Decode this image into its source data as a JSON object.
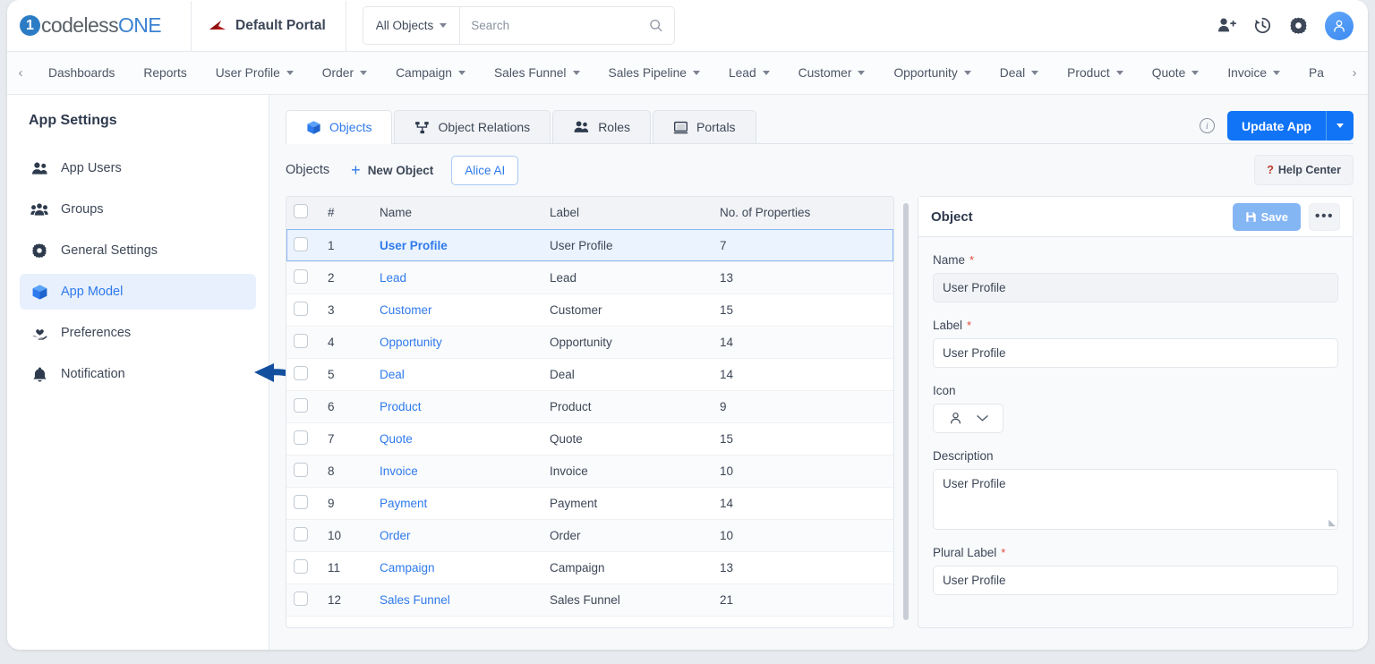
{
  "brand": {
    "logo_digit": "1",
    "logo_part1": "codeless",
    "logo_part2": "ONE"
  },
  "topbar": {
    "portal_name": "Default Portal",
    "search_scope": "All Objects",
    "search_placeholder": "Search",
    "icons": [
      "add-user-icon",
      "history-icon",
      "gear-icon",
      "avatar-icon"
    ]
  },
  "navbar": {
    "prev_label": "‹",
    "next_label": "›",
    "items": [
      {
        "label": "Dashboards",
        "dropdown": false
      },
      {
        "label": "Reports",
        "dropdown": false
      },
      {
        "label": "User Profile",
        "dropdown": true
      },
      {
        "label": "Order",
        "dropdown": true
      },
      {
        "label": "Campaign",
        "dropdown": true
      },
      {
        "label": "Sales Funnel",
        "dropdown": true
      },
      {
        "label": "Sales Pipeline",
        "dropdown": true
      },
      {
        "label": "Lead",
        "dropdown": true
      },
      {
        "label": "Customer",
        "dropdown": true
      },
      {
        "label": "Opportunity",
        "dropdown": true
      },
      {
        "label": "Deal",
        "dropdown": true
      },
      {
        "label": "Product",
        "dropdown": true
      },
      {
        "label": "Quote",
        "dropdown": true
      },
      {
        "label": "Invoice",
        "dropdown": true
      },
      {
        "label": "Pa",
        "dropdown": false
      }
    ]
  },
  "sidebar": {
    "title": "App Settings",
    "items": [
      {
        "label": "App Users",
        "icon": "users-icon",
        "active": false
      },
      {
        "label": "Groups",
        "icon": "group-icon",
        "active": false
      },
      {
        "label": "General Settings",
        "icon": "gear-icon",
        "active": false
      },
      {
        "label": "App Model",
        "icon": "cube-icon",
        "active": true
      },
      {
        "label": "Preferences",
        "icon": "hand-heart-icon",
        "active": false
      },
      {
        "label": "Notification",
        "icon": "bell-icon",
        "active": false
      }
    ]
  },
  "tabs": [
    {
      "label": "Objects",
      "icon": "cube-icon",
      "active": true
    },
    {
      "label": "Object Relations",
      "icon": "relations-icon",
      "active": false
    },
    {
      "label": "Roles",
      "icon": "users-icon",
      "active": false
    },
    {
      "label": "Portals",
      "icon": "monitor-icon",
      "active": false
    }
  ],
  "header_actions": {
    "info_label": "i",
    "update_app": "Update App"
  },
  "toolbar": {
    "title": "Objects",
    "new_object": "New Object",
    "alice_ai": "Alice AI",
    "help_center": "Help Center",
    "help_q": "?"
  },
  "table": {
    "columns": [
      "#",
      "Name",
      "Label",
      "No. of Properties"
    ],
    "rows": [
      {
        "num": "1",
        "name": "User Profile",
        "label": "User Profile",
        "props": "7",
        "selected": true
      },
      {
        "num": "2",
        "name": "Lead",
        "label": "Lead",
        "props": "13",
        "selected": false
      },
      {
        "num": "3",
        "name": "Customer",
        "label": "Customer",
        "props": "15",
        "selected": false
      },
      {
        "num": "4",
        "name": "Opportunity",
        "label": "Opportunity",
        "props": "14",
        "selected": false
      },
      {
        "num": "5",
        "name": "Deal",
        "label": "Deal",
        "props": "14",
        "selected": false
      },
      {
        "num": "6",
        "name": "Product",
        "label": "Product",
        "props": "9",
        "selected": false
      },
      {
        "num": "7",
        "name": "Quote",
        "label": "Quote",
        "props": "15",
        "selected": false
      },
      {
        "num": "8",
        "name": "Invoice",
        "label": "Invoice",
        "props": "10",
        "selected": false
      },
      {
        "num": "9",
        "name": "Payment",
        "label": "Payment",
        "props": "14",
        "selected": false
      },
      {
        "num": "10",
        "name": "Order",
        "label": "Order",
        "props": "10",
        "selected": false
      },
      {
        "num": "11",
        "name": "Campaign",
        "label": "Campaign",
        "props": "13",
        "selected": false
      },
      {
        "num": "12",
        "name": "Sales Funnel",
        "label": "Sales Funnel",
        "props": "21",
        "selected": false
      }
    ]
  },
  "detail": {
    "title": "Object",
    "save_label": "Save",
    "more_label": "•••",
    "fields": {
      "name_label": "Name",
      "name_value": "User Profile",
      "label_label": "Label",
      "label_value": "User Profile",
      "icon_label": "Icon",
      "icon_value": "person-icon",
      "description_label": "Description",
      "description_value": "User Profile",
      "plural_label_label": "Plural Label",
      "plural_label_value": "User Profile"
    },
    "required_marker": "*"
  },
  "colors": {
    "accent": "#2f7aec",
    "primary_button": "#1173f5",
    "save_button": "#85b6f4",
    "selected_row": "#eaf3fe",
    "required": "#e74c3c",
    "annotation_arrow": "#12509f",
    "brand_blue": "#3b83d0",
    "portal_logo": "#b11818"
  }
}
